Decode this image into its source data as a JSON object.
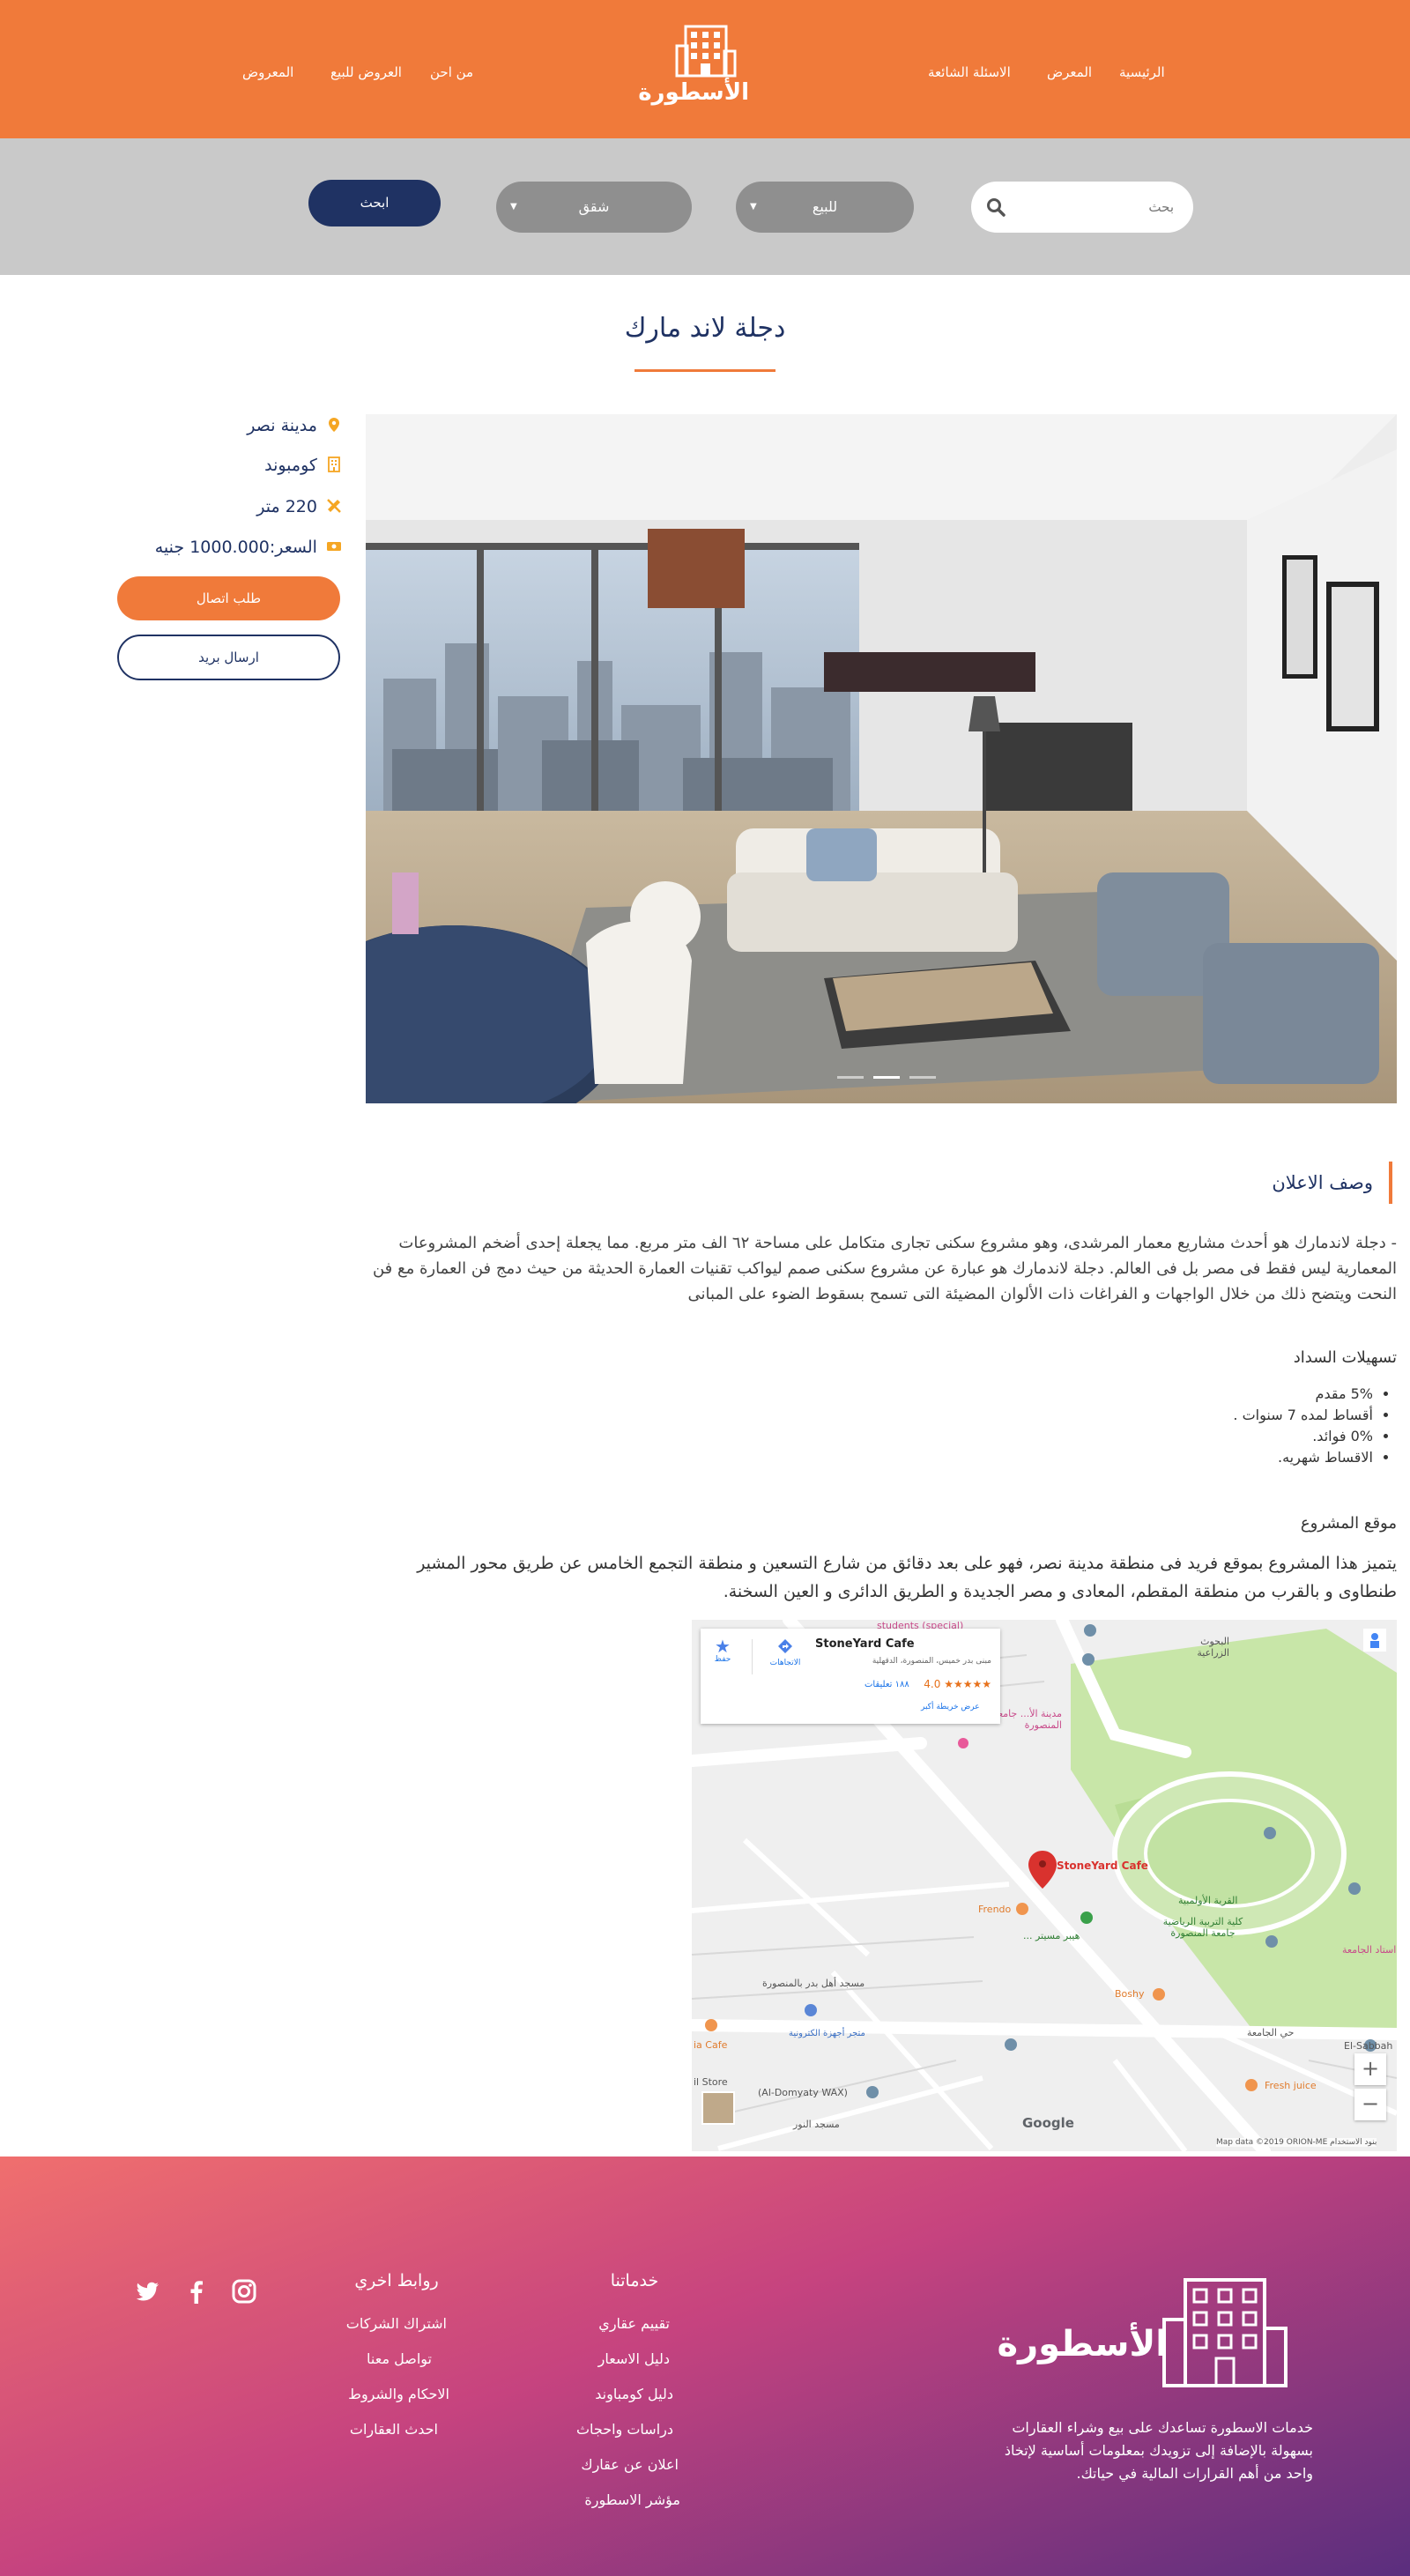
{
  "header": {
    "logo_text": "الأسطورة",
    "nav_right": [
      "الرئيسية",
      "المعرض",
      "الاسئلة الشائعة"
    ],
    "nav_left": [
      "من احن",
      "العروض للبيع",
      "المعروض"
    ]
  },
  "search": {
    "placeholder": "بحث",
    "type_value": "للبيع",
    "category_value": "شقق",
    "button_label": "ابحث"
  },
  "listing": {
    "title": "دجلة لاند مارك",
    "location": "مدينة نصر",
    "kind": "كومبوند",
    "area": "220 متر",
    "price": "السعر:1000.000 جنيه",
    "contact_button": "طلب اتصال",
    "mail_button": "ارسال بريد"
  },
  "gallery": {
    "slide_count": 3,
    "active_slide": 2
  },
  "description": {
    "heading": "وصف الاعلان",
    "text": "- دجلة لاندمارك هو أحدث مشاريع معمار المرشدى، وهو مشروع سكنى تجارى متكامل على مساحة ٦٢ الف متر مربع. مما يجعلة إحدى أضخم المشروعات المعمارية ليس فقط فى مصر بل فى العالم. دجلة لاندمارك هو عبارة عن مشروع سكنى صمم ليواكب تقنيات العمارة الحديثة من حيث دمج فن العمارة مع فن النحت ويتضح ذلك من خلال الواجهات و الفراغات ذات الألوان المضيئة التى تسمح بسقوط الضوء على المبانى",
    "payment_heading": "تسهيلات السداد",
    "payment_items": [
      "5% مقدم",
      "أقساط لمده 7 سنوات .",
      "0% فوائد.",
      "الاقساط شهريه."
    ],
    "location_heading": "موقع المشروع",
    "location_text": "يتميز هذا المشروع بموقع فريد فى منطقة مدينة نصر، فهو على بعد دقائق من شارع التسعين و منطقة التجمع الخامس عن طريق محور المشير طنطاوى و بالقرب من منطقة المقطم، المعادى و مصر الجديدة و الطريق الدائرى و العين السخنة."
  },
  "map": {
    "place_name": "StoneYard Cafe",
    "place_address": "مبنى بدر خميس، المنصورة، الدقهلية",
    "rating": "4.0",
    "stars": "★★★★★",
    "reviews": "١٨٨ تعليقات",
    "directions_label": "الاتجاهات",
    "save_label": "حفظ",
    "larger_map": "عرض خريطة أكبر",
    "marker_label": "StoneYard Cafe",
    "labels": {
      "agri_research": "البحوث الزراعية",
      "olympic_village": "القرية الأولمبية",
      "sports_college": "كلية التربية الرياضية جامعة المنصورة",
      "stadium": "استاد الجامعة",
      "hyper": "هيبر مسيتر ...",
      "frendo": "Frendo",
      "boshy": "Boshy",
      "fresh_juice": "Fresh juice",
      "el_sabbah": "El-Sabbah",
      "mosque_badr": "مسجد أهل بدر بالمنصورة",
      "electronics": "متجر أجهزة الكترونية",
      "domyaty": "(Al-Domyaty WAX)",
      "mosque_noor": "مسجد النور",
      "ia_cafe": "ia Cafe",
      "il_store": "il Store",
      "students": "students (special)",
      "mansoura_city": "مدينة الأ... جامعة المنصورة",
      "university_district": "حي الجامعة",
      "google": "Google",
      "footer": "Map data ©2019 ORION-ME   بنود الاستخدام"
    }
  },
  "footer": {
    "logo_text": "الأسطورة",
    "about": "خدمات الاسطورة تساعدك على بيع وشراء العقارات بسهولة بالإضافة إلى تزويدك بمعلومات أساسية لإتخاذ واحد من أهم القرارات المالية في حياتك.",
    "services_heading": "خدماتنا",
    "services": [
      "تقييم عقاري",
      "دليل الاسعار",
      "دليل كومباوند",
      "دراسات واحجاث",
      "اعلان عن عقارك",
      "مؤشر الاسطورة"
    ],
    "links_heading": "روابط اخري",
    "links": [
      "اشتراك الشركات",
      "تواصل معنا",
      "الاحكام والشروط",
      "احدث العقارات"
    ]
  },
  "colors": {
    "orange": "#f07a3a",
    "navy": "#1f3263",
    "gray_bar": "#c9c9c9"
  }
}
